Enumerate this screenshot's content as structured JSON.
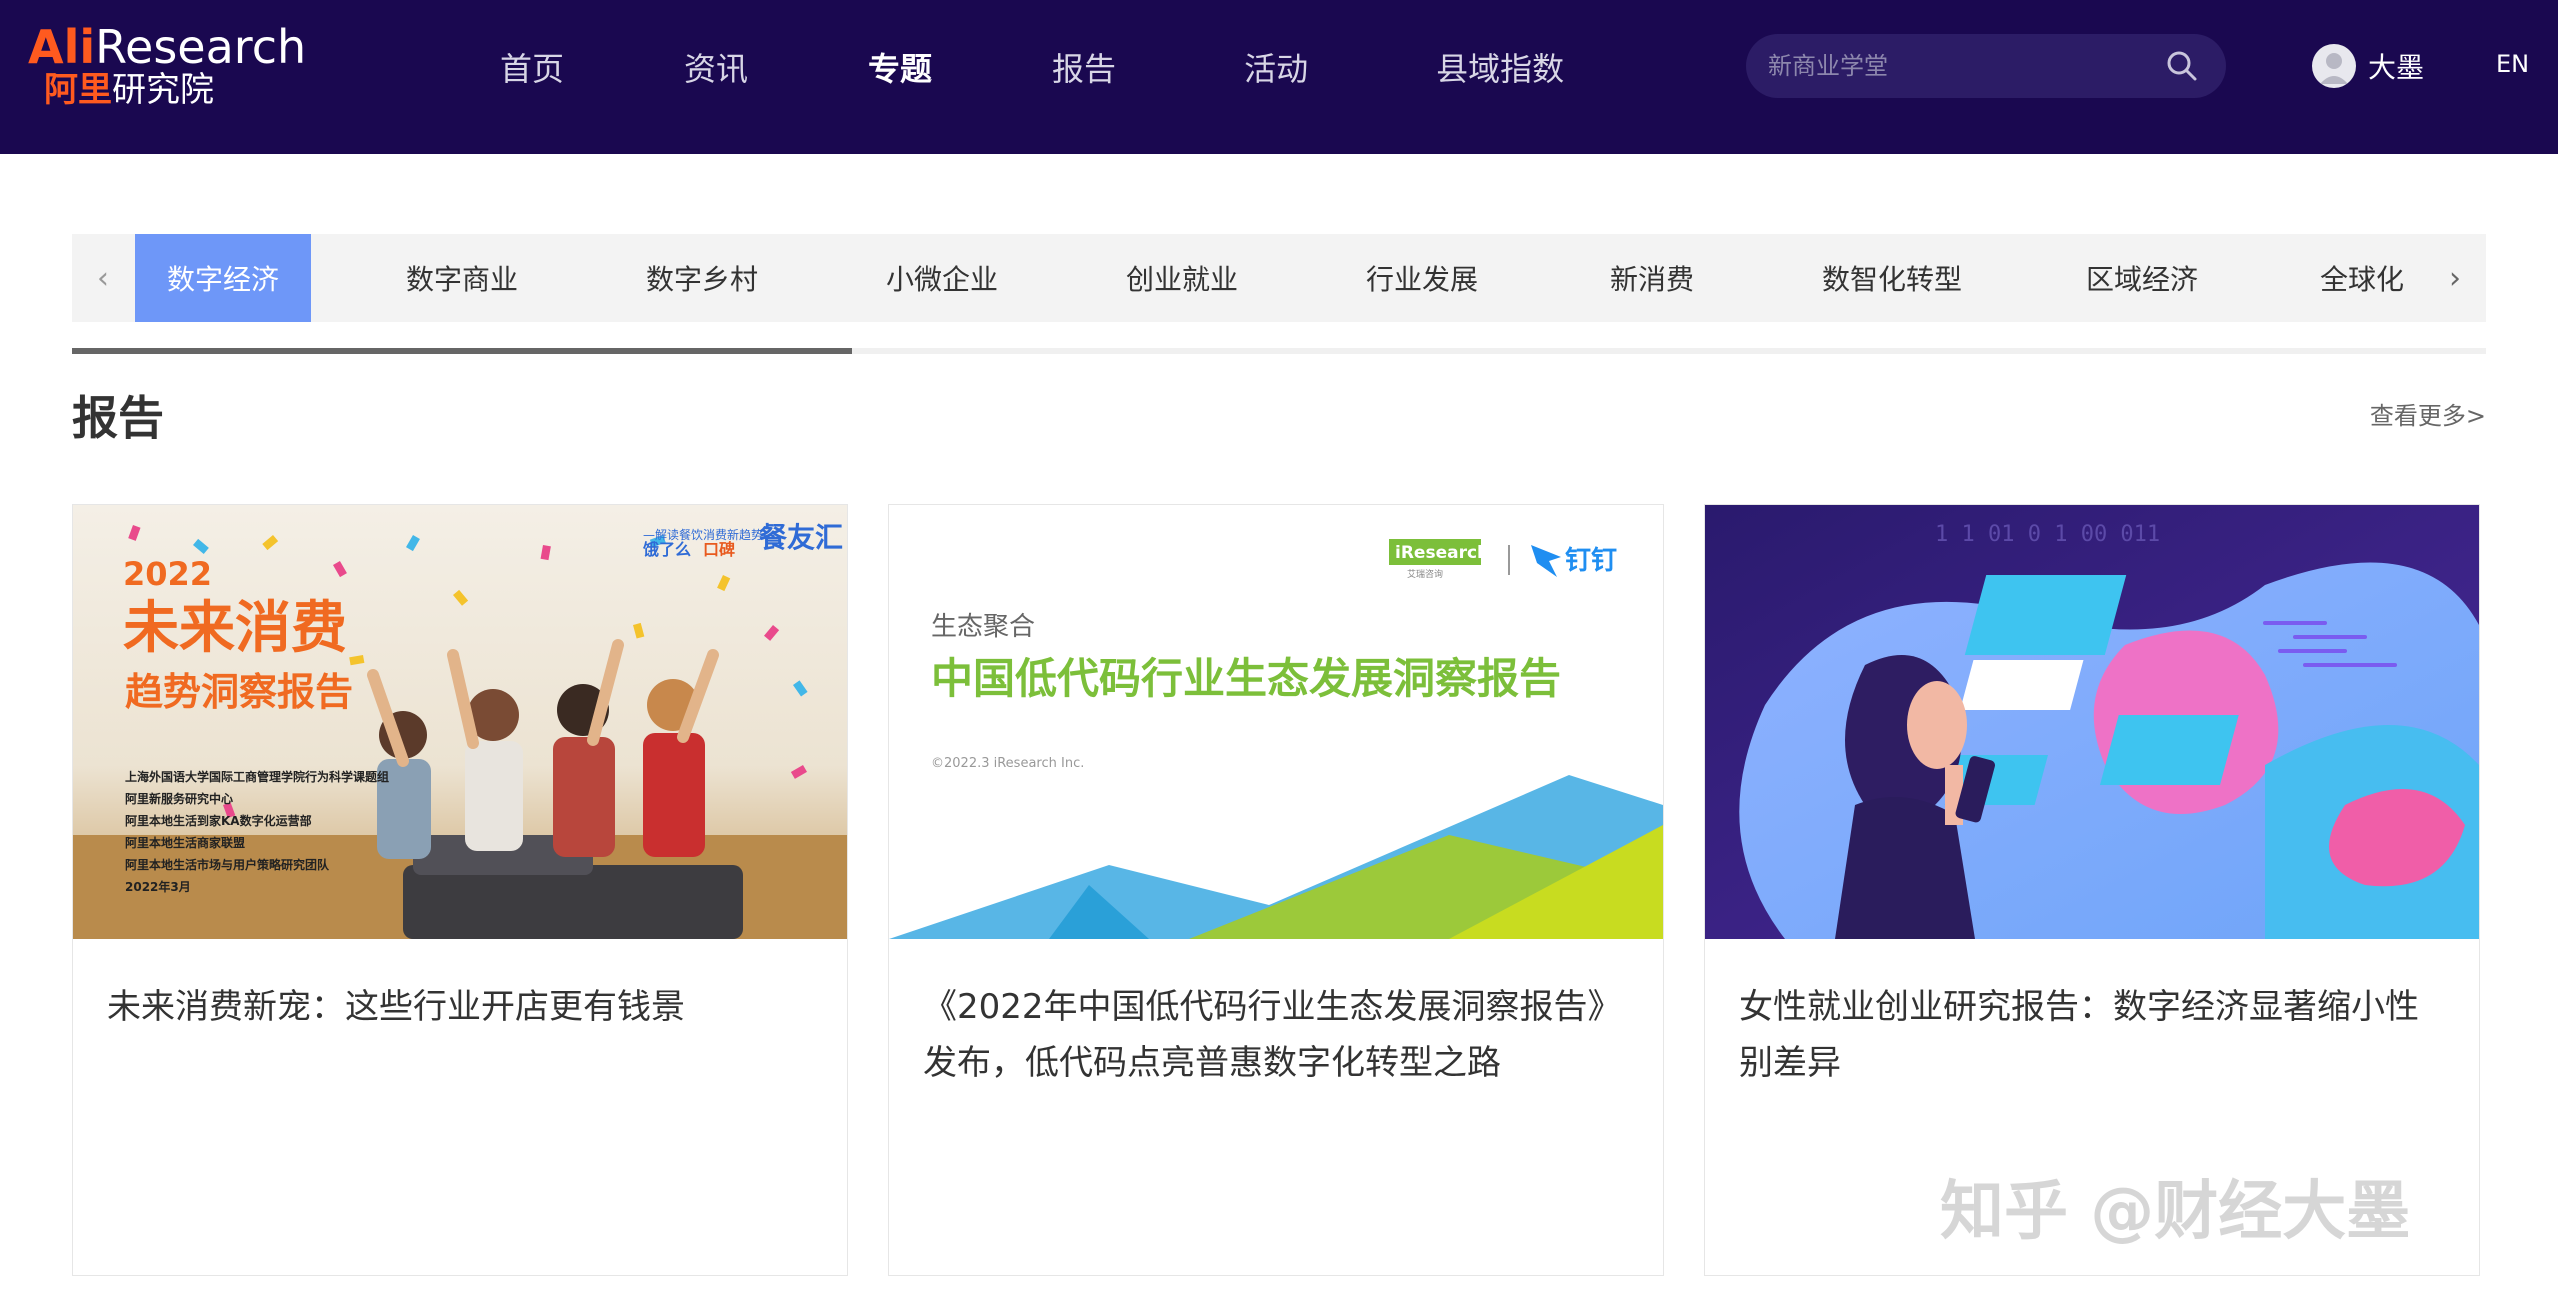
{
  "header": {
    "logo_en_prefix": "Ali",
    "logo_en_suffix": "Research",
    "logo_cn_prefix": "阿里",
    "logo_cn_suffix": "研究院",
    "nav": [
      {
        "label": "首页",
        "active": false
      },
      {
        "label": "资讯",
        "active": false
      },
      {
        "label": "专题",
        "active": true
      },
      {
        "label": "报告",
        "active": false
      },
      {
        "label": "活动",
        "active": false
      },
      {
        "label": "县域指数",
        "active": false
      }
    ],
    "search_placeholder": "新商业学堂",
    "user_name": "大墨",
    "lang": "EN"
  },
  "categories": {
    "items": [
      "数字经济",
      "数字商业",
      "数字乡村",
      "小微企业",
      "创业就业",
      "行业发展",
      "新消费",
      "数智化转型",
      "区域经济",
      "全球化"
    ],
    "active_index": 0,
    "prev_arrow": "‹",
    "next_arrow": "›",
    "scroll_progress": 0.323
  },
  "section": {
    "title": "报告",
    "more": "查看更多>"
  },
  "cards": [
    {
      "title": "未来消费新宠：这些行业开店更有钱景",
      "image": {
        "year": "2022",
        "headline": "未来消费",
        "subhead": "趋势洞察报告",
        "brand": "餐友汇",
        "brand_small": "饿了么",
        "brand_small2": "口碑",
        "tagline": "—解读餐饮消费新趋势—",
        "credits": [
          "上海外国语大学国际工商管理学院行为科学课题组",
          "阿里新服务研究中心",
          "阿里本地生活到家KA数字化运营部",
          "阿里本地生活商家联盟",
          "阿里本地生活市场与用户策略研究团队"
        ],
        "date": "2022年3月"
      }
    },
    {
      "title": "《2022年中国低代码行业生态发展洞察报告》发布，低代码点亮普惠数字化转型之路",
      "image": {
        "brand1": "iResearch",
        "brand1_sub": "艾瑞咨询",
        "brand2": "钉钉",
        "kicker": "生态聚合",
        "headline": "中国低代码行业生态发展洞察报告",
        "copyright": "©2022.3 iResearch Inc."
      }
    },
    {
      "title": "女性就业创业研究报告：数字经济显著缩小性别差异",
      "image": {
        "binary": "1 1        01  0  1   00  011"
      }
    }
  ],
  "watermark": "知乎 @财经大墨",
  "colors": {
    "header_bg": "#1a0850",
    "accent_orange": "#ff5a1f",
    "tab_active": "#6e97f8",
    "green_headline": "#8cc63e"
  }
}
